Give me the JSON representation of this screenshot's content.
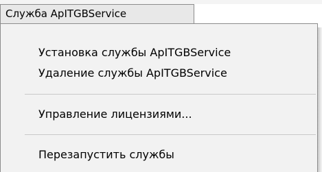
{
  "menu": {
    "title": "Служба ApITGBService",
    "items": [
      {
        "label": "Установка службы ApITGBService"
      },
      {
        "label": "Удаление службы ApITGBService"
      },
      {
        "label": "Управление лицензиями..."
      },
      {
        "label": "Перезапустить службы"
      }
    ]
  }
}
